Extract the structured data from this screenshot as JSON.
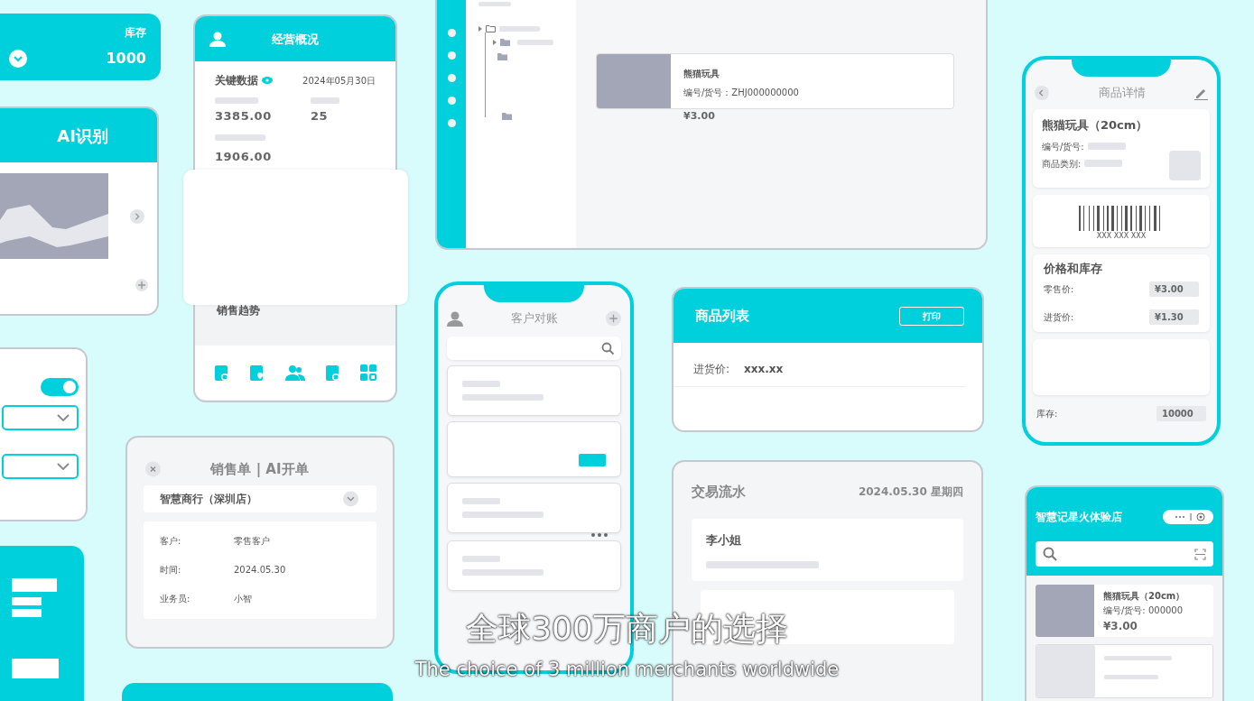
{
  "inventory_card": {
    "label": "库存",
    "value": "1000"
  },
  "ai_card": {
    "title": "AI识别"
  },
  "settings_panel": {
    "toggle": {
      "on": true
    }
  },
  "overview_phone": {
    "title": "经营概况",
    "section": "关键数据",
    "date": "2024年05月30日",
    "stats": [
      {
        "value": "3385.00"
      },
      {
        "value": "25"
      },
      {
        "value": "1906.00"
      }
    ],
    "trend_title": "销售趋势"
  },
  "sales_order_dialog": {
    "title": "销售单 | AI开单",
    "store": "智慧商行（深圳店）",
    "fields": [
      {
        "label": "客户:",
        "value": "零售客户"
      },
      {
        "label": "时间:",
        "value": "2024.05.30"
      },
      {
        "label": "业务员:",
        "value": "小智"
      }
    ]
  },
  "desktop_window": {
    "product": {
      "name": "熊猫玩具",
      "code": "编号/货号：ZHJ000000000",
      "price": "¥3.00"
    }
  },
  "reconcile_phone": {
    "title": "客户对账"
  },
  "product_list_card": {
    "title": "商品列表",
    "print_button": "打印",
    "field": {
      "label": "进货价:",
      "value": "xxx.xx"
    }
  },
  "transactions_card": {
    "title": "交易流水",
    "date": "2024.05.30 星期四",
    "entries": [
      {
        "name": "李小姐"
      }
    ]
  },
  "detail_phone": {
    "title": "商品详情",
    "product_name": "熊猫玩具（20cm）",
    "fields": [
      {
        "label": "编号/货号:"
      },
      {
        "label": "商品类别:"
      }
    ],
    "barcode": "XXX XXX XXX",
    "price_section": "价格和库存",
    "prices": [
      {
        "label": "零售价:",
        "value": "¥3.00"
      },
      {
        "label": "进货价:",
        "value": "¥1.30"
      }
    ],
    "stock": {
      "label": "库存:",
      "value": "10000"
    }
  },
  "shop_phone": {
    "title": "智慧记星火体验店",
    "products": [
      {
        "name": "熊猫玩具（20cm）",
        "code": "编号/货号: 000000",
        "price": "¥3.00"
      }
    ]
  },
  "subtitles": [
    "全球300万商户的选择",
    "The choice of 3 million merchants worldwide"
  ]
}
